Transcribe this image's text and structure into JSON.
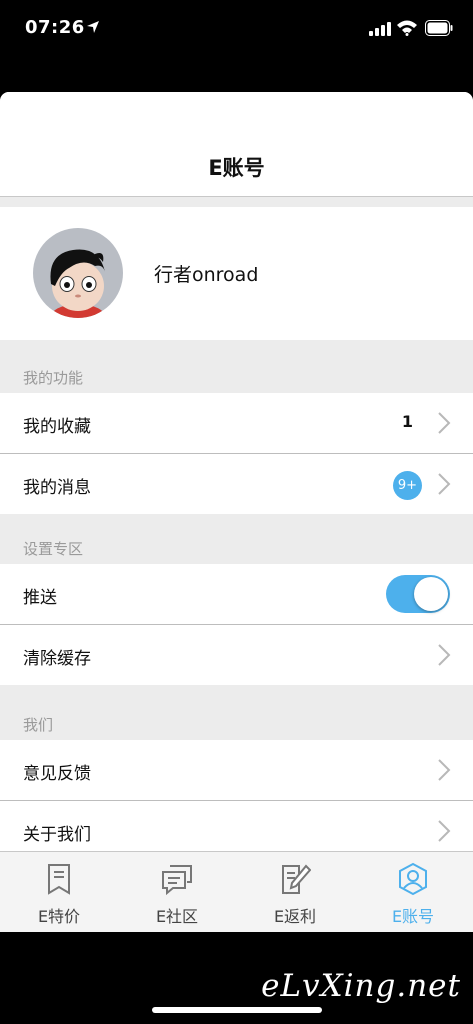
{
  "status": {
    "time": "07:26"
  },
  "nav": {
    "title": "E账号"
  },
  "profile": {
    "username": "行者onroad"
  },
  "sections": {
    "functions": {
      "header": "我的功能",
      "favorites_label": "我的收藏",
      "favorites_count": "1",
      "messages_label": "我的消息",
      "messages_badge": "9+"
    },
    "settings": {
      "header": "设置专区",
      "push_label": "推送",
      "push_enabled": true,
      "clear_cache_label": "清除缓存"
    },
    "about": {
      "header": "我们",
      "feedback_label": "意见反馈",
      "about_label": "关于我们"
    }
  },
  "tabs": [
    {
      "label": "E特价",
      "icon": "bookmark-icon"
    },
    {
      "label": "E社区",
      "icon": "chat-icon"
    },
    {
      "label": "E返利",
      "icon": "pencil-note-icon"
    },
    {
      "label": "E账号",
      "icon": "user-icon",
      "active": true
    }
  ],
  "colors": {
    "accent": "#4db0ec",
    "section_bg": "#ececec"
  },
  "watermark": "eLvXing.net"
}
